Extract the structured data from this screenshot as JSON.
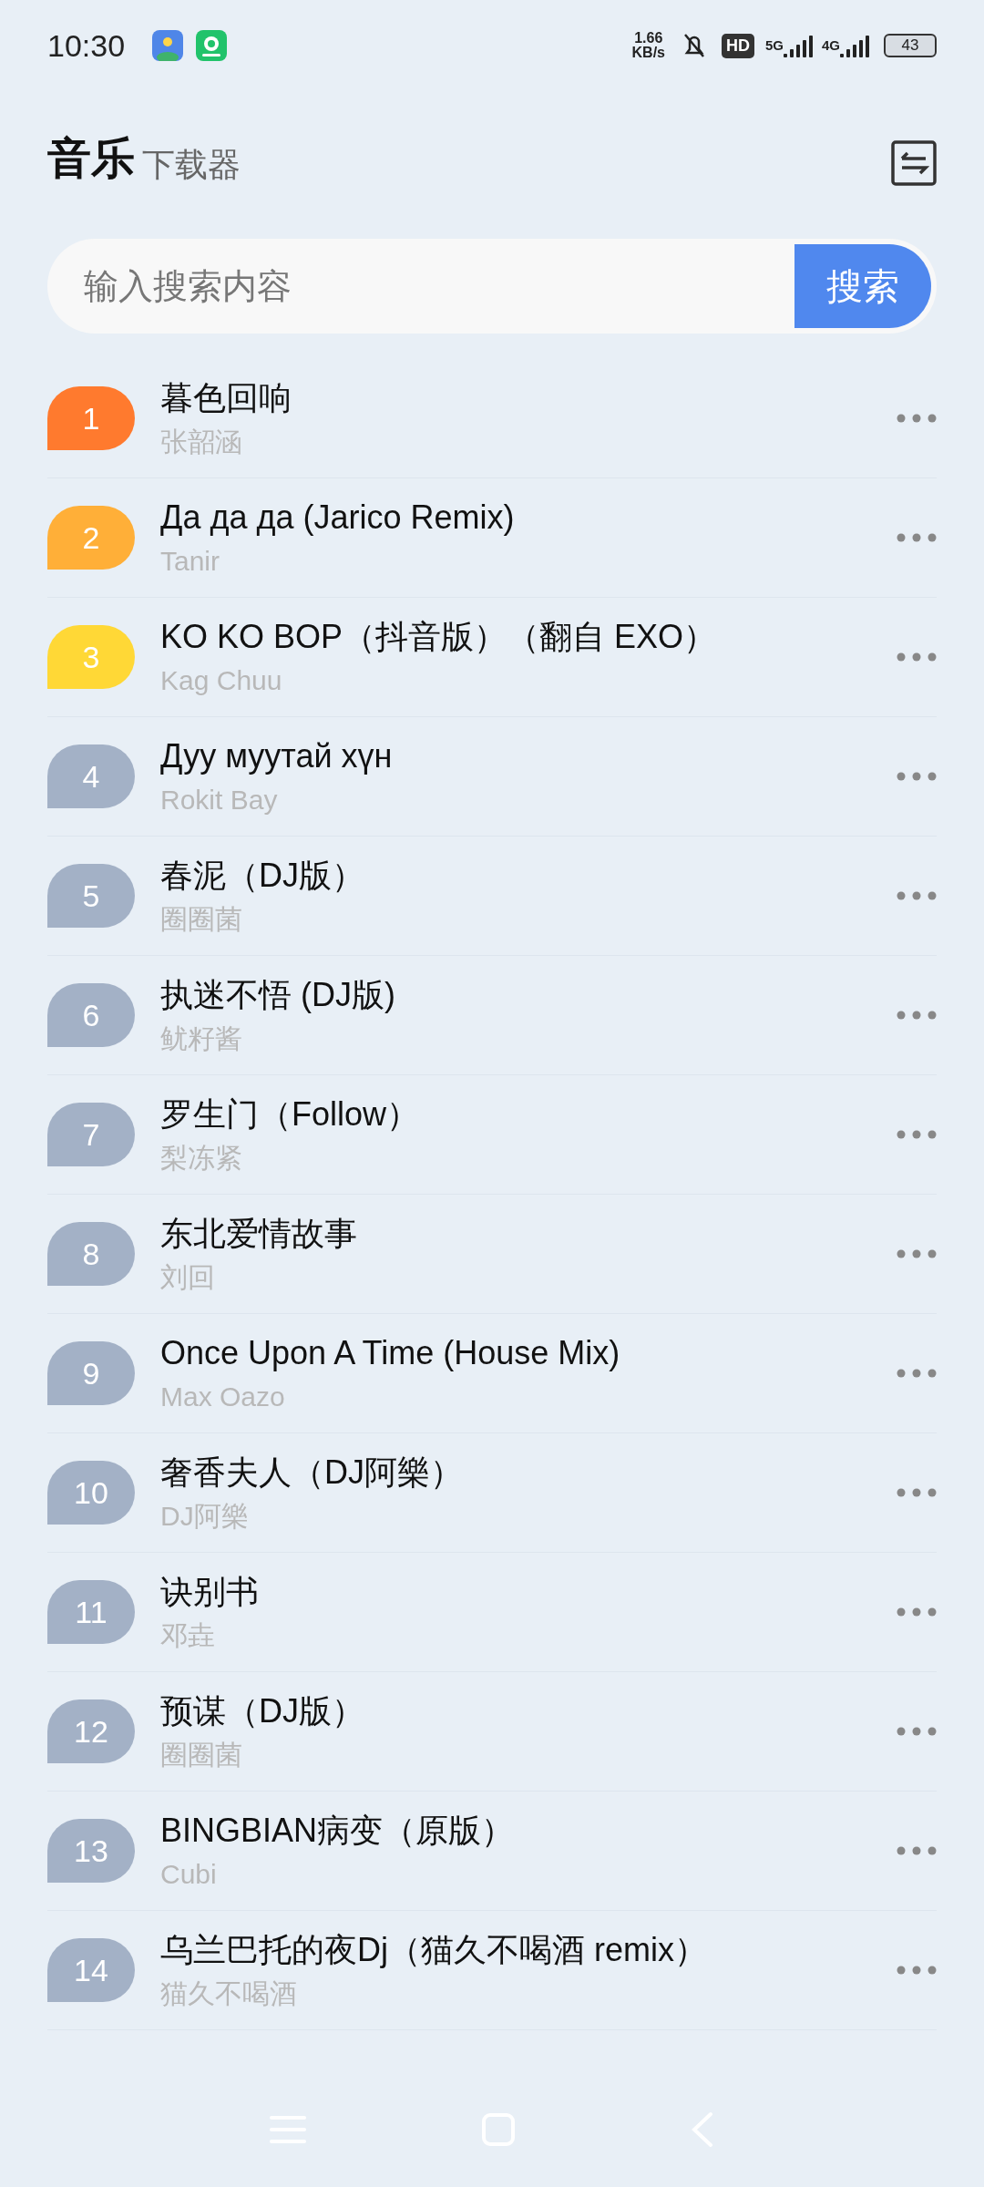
{
  "status_bar": {
    "time": "10:30",
    "net_speed_value": "1.66",
    "net_speed_unit": "KB/s",
    "hd": "HD",
    "net_5g": "5G",
    "net_4g": "4G",
    "battery": "43"
  },
  "header": {
    "title": "音乐",
    "subtitle": "下载器"
  },
  "search": {
    "placeholder": "输入搜索内容",
    "button": "搜索"
  },
  "songs": [
    {
      "rank": "1",
      "title": "暮色回响",
      "artist": "张韶涵",
      "color": "#ff7a2e"
    },
    {
      "rank": "2",
      "title": "Да да да (Jarico Remix)",
      "artist": "Tanir",
      "color": "#ffaf38"
    },
    {
      "rank": "3",
      "title": "KO KO BOP（抖音版）（翻自 EXO）",
      "artist": "Kag Chuu",
      "color": "#ffd836"
    },
    {
      "rank": "4",
      "title": "Дуу муутай хүн",
      "artist": "Rokit Bay",
      "color": "#a3b1c6"
    },
    {
      "rank": "5",
      "title": "春泥（DJ版）",
      "artist": "圈圈菌",
      "color": "#a3b1c6"
    },
    {
      "rank": "6",
      "title": "执迷不悟 (DJ版)",
      "artist": "鱿籽酱",
      "color": "#a3b1c6"
    },
    {
      "rank": "7",
      "title": "罗生门（Follow）",
      "artist": "梨冻紧",
      "color": "#a3b1c6"
    },
    {
      "rank": "8",
      "title": "东北爱情故事",
      "artist": "刘回",
      "color": "#a3b1c6"
    },
    {
      "rank": "9",
      "title": "Once Upon A Time (House Mix)",
      "artist": "Max Oazo",
      "color": "#a3b1c6"
    },
    {
      "rank": "10",
      "title": "奢香夫人（DJ阿樂）",
      "artist": "DJ阿樂",
      "color": "#a3b1c6"
    },
    {
      "rank": "11",
      "title": "诀别书",
      "artist": "邓垚",
      "color": "#a3b1c6"
    },
    {
      "rank": "12",
      "title": "预谋（DJ版）",
      "artist": "圈圈菌",
      "color": "#a3b1c6"
    },
    {
      "rank": "13",
      "title": "BINGBIAN病变（原版）",
      "artist": "Cubi",
      "color": "#a3b1c6"
    },
    {
      "rank": "14",
      "title": "乌兰巴托的夜Dj（猫久不喝酒 remix）",
      "artist": "猫久不喝酒",
      "color": "#a3b1c6"
    }
  ]
}
